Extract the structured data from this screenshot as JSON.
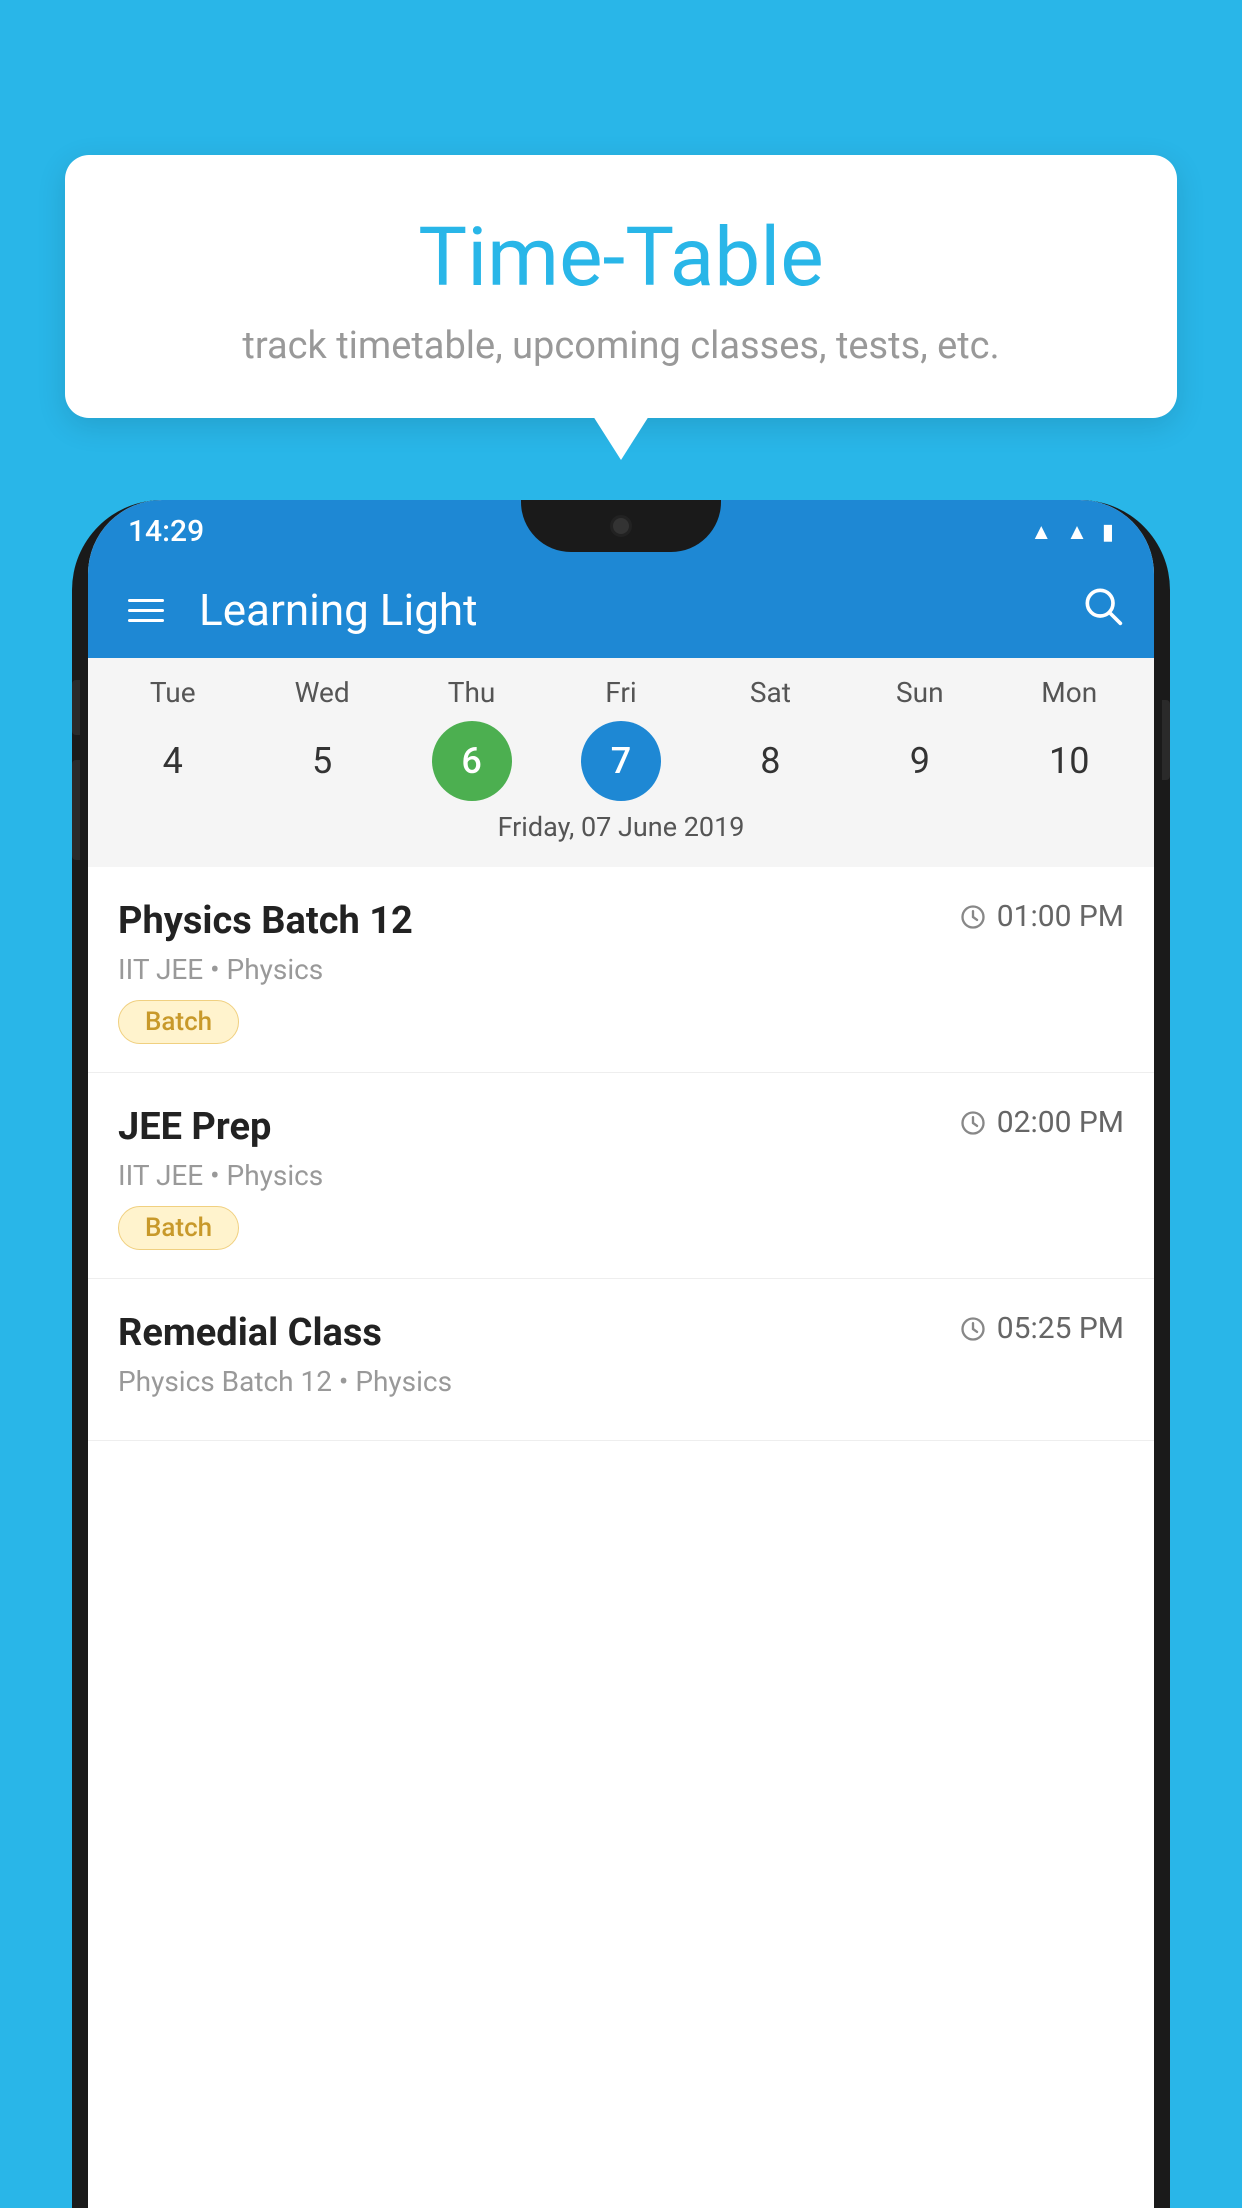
{
  "background_color": "#29B6E8",
  "tooltip": {
    "title": "Time-Table",
    "subtitle": "track timetable, upcoming classes, tests, etc."
  },
  "phone": {
    "status_bar": {
      "time": "14:29",
      "icons": [
        "wifi",
        "signal",
        "battery"
      ]
    },
    "header": {
      "title": "Learning Light",
      "menu_icon": "hamburger",
      "search_icon": "search"
    },
    "calendar": {
      "days": [
        {
          "name": "Tue",
          "num": "4",
          "state": "normal"
        },
        {
          "name": "Wed",
          "num": "5",
          "state": "normal"
        },
        {
          "name": "Thu",
          "num": "6",
          "state": "today"
        },
        {
          "name": "Fri",
          "num": "7",
          "state": "selected"
        },
        {
          "name": "Sat",
          "num": "8",
          "state": "normal"
        },
        {
          "name": "Sun",
          "num": "9",
          "state": "normal"
        },
        {
          "name": "Mon",
          "num": "10",
          "state": "normal"
        }
      ],
      "selected_date_label": "Friday, 07 June 2019"
    },
    "schedule": [
      {
        "title": "Physics Batch 12",
        "time": "01:00 PM",
        "subtitle": "IIT JEE • Physics",
        "badge": "Batch"
      },
      {
        "title": "JEE Prep",
        "time": "02:00 PM",
        "subtitle": "IIT JEE • Physics",
        "badge": "Batch"
      },
      {
        "title": "Remedial Class",
        "time": "05:25 PM",
        "subtitle": "Physics Batch 12 • Physics",
        "badge": null
      }
    ]
  }
}
